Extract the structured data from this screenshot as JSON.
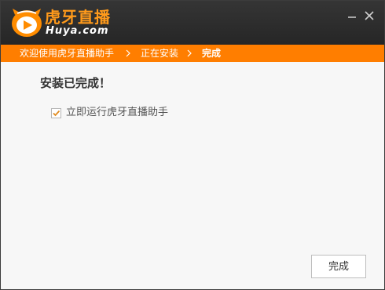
{
  "app": {
    "brand_name": "虎牙直播",
    "brand_url": "Huya.com",
    "logo_icon": "huya-mascot-icon",
    "accent_color": "#ff7e00"
  },
  "window_controls": {
    "minimize_icon": "minimize-icon",
    "close_icon": "close-icon"
  },
  "steps": [
    {
      "label": "欢迎使用虎牙直播助手"
    },
    {
      "label": "正在安装"
    },
    {
      "label": "完成",
      "active": true
    }
  ],
  "main": {
    "headline": "安装已完成！",
    "run_checkbox": {
      "label": "立即运行虎牙直播助手",
      "checked": true
    },
    "finish_button": "完成"
  }
}
